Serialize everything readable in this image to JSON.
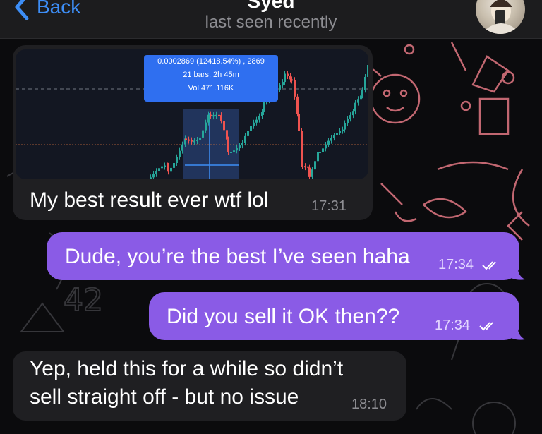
{
  "header": {
    "back_label": "Back",
    "contact_name": "Syed",
    "status": "last seen recently"
  },
  "chart_card": {
    "tooltip_line1": "0.0002869 (12418.54%) , 2869",
    "tooltip_line2": "21 bars, 2h 45m",
    "tooltip_line3": "Vol 471.116K"
  },
  "messages": [
    {
      "id": "m1",
      "direction": "incoming",
      "text": "My best result ever wtf lol",
      "time": "17:31"
    },
    {
      "id": "m2",
      "direction": "outgoing",
      "text": "Dude, you’re the best I’ve seen haha",
      "time": "17:34",
      "status": "read"
    },
    {
      "id": "m3",
      "direction": "outgoing",
      "text": "Did you sell it OK then??",
      "time": "17:34",
      "status": "read"
    },
    {
      "id": "m4",
      "direction": "incoming",
      "text_line1": "Yep, held this for a while so didn’t",
      "text_line2": "sell straight off - but no issue",
      "time": "18:10"
    }
  ],
  "colors": {
    "accent": "#3d8ef7",
    "outgoing_bubble": "#8a5be6",
    "incoming_bubble": "#1f1f22",
    "doodle": "#f07f8a"
  }
}
